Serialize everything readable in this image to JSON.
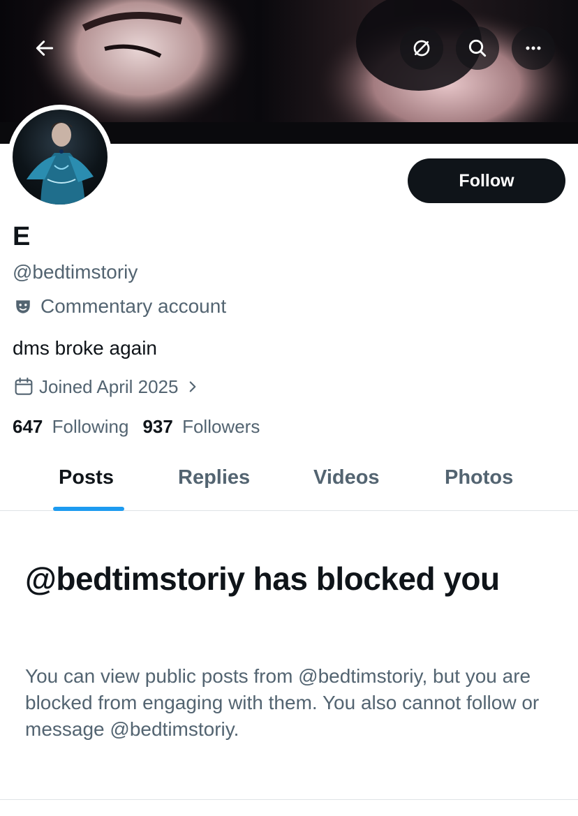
{
  "profile": {
    "display_name": "E",
    "handle": "@bedtimstoriy",
    "label": "Commentary account",
    "bio": "dms broke again",
    "joined": "Joined April 2025",
    "following_count": "647",
    "following_label": "Following",
    "followers_count": "937",
    "followers_label": "Followers"
  },
  "actions": {
    "follow_label": "Follow"
  },
  "header_icons": [
    "back-arrow-icon",
    "rotate-icon",
    "search-icon",
    "more-icon"
  ],
  "tabs": [
    {
      "label": "Posts",
      "active": true
    },
    {
      "label": "Replies",
      "active": false
    },
    {
      "label": "Videos",
      "active": false
    },
    {
      "label": "Photos",
      "active": false
    }
  ],
  "blocked": {
    "title": "@bedtimstoriy has blocked you",
    "description": "You can view public posts from @bedtimstoriy, but you are blocked from engaging with them. You also cannot follow or message @bedtimstoriy."
  },
  "colors": {
    "text_primary": "#0f1419",
    "text_secondary": "#536471",
    "accent": "#1d9bf0",
    "button_bg": "#0f1419"
  }
}
